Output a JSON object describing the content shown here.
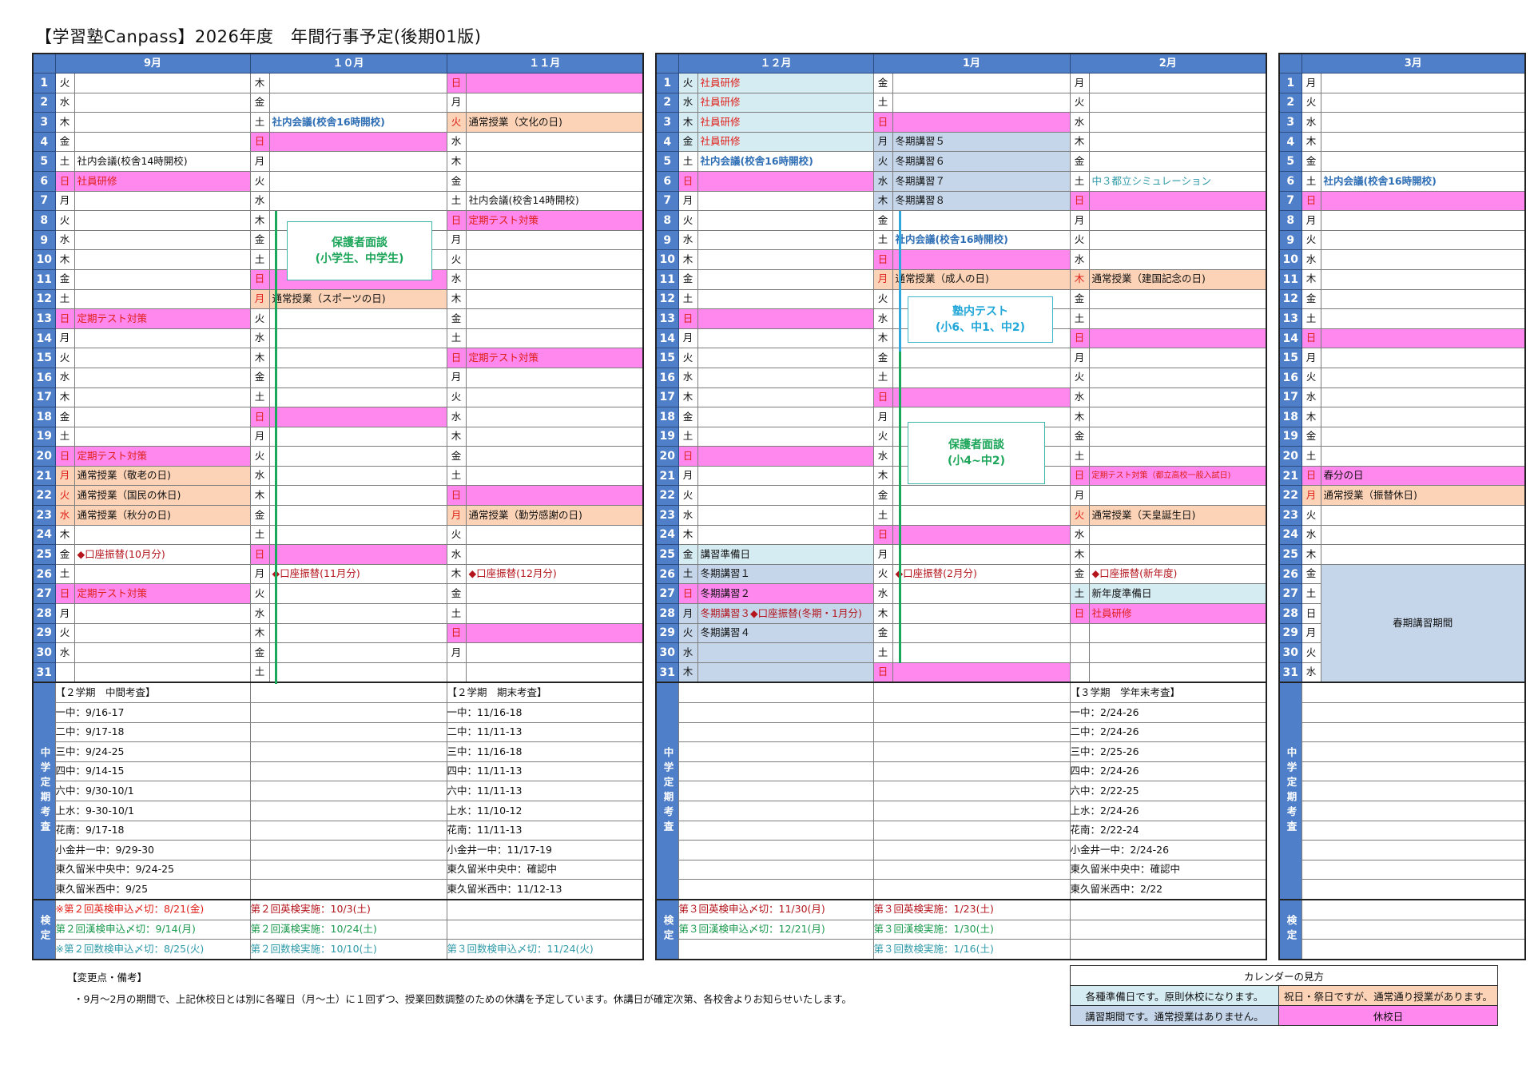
{
  "title": "【学習塾Canpass】2026年度　年間行事予定(後期01版)",
  "months": [
    {
      "name": "9月",
      "days": [
        [
          "火",
          ""
        ],
        [
          "水",
          ""
        ],
        [
          "木",
          ""
        ],
        [
          "金",
          ""
        ],
        [
          "土",
          "社内会議(校舎14時開校)"
        ],
        [
          "日",
          "社員研修"
        ],
        [
          "月",
          ""
        ],
        [
          "火",
          ""
        ],
        [
          "水",
          ""
        ],
        [
          "木",
          ""
        ],
        [
          "金",
          ""
        ],
        [
          "土",
          ""
        ],
        [
          "日",
          "定期テスト対策"
        ],
        [
          "月",
          ""
        ],
        [
          "火",
          ""
        ],
        [
          "水",
          ""
        ],
        [
          "木",
          ""
        ],
        [
          "金",
          ""
        ],
        [
          "土",
          ""
        ],
        [
          "日",
          "定期テスト対策"
        ],
        [
          "月",
          "通常授業（敬老の日)"
        ],
        [
          "火",
          "通常授業（国民の休日)"
        ],
        [
          "水",
          "通常授業（秋分の日)"
        ],
        [
          "木",
          ""
        ],
        [
          "金",
          "◆口座振替(10月分)"
        ],
        [
          "土",
          ""
        ],
        [
          "日",
          "定期テスト対策"
        ],
        [
          "月",
          ""
        ],
        [
          "火",
          ""
        ],
        [
          "水",
          ""
        ],
        [
          "",
          ""
        ]
      ]
    },
    {
      "name": "１０月",
      "days": [
        [
          "木",
          ""
        ],
        [
          "金",
          ""
        ],
        [
          "土",
          "社内会議(校舎16時開校)"
        ],
        [
          "日",
          ""
        ],
        [
          "月",
          ""
        ],
        [
          "火",
          ""
        ],
        [
          "水",
          ""
        ],
        [
          "木",
          ""
        ],
        [
          "金",
          ""
        ],
        [
          "土",
          ""
        ],
        [
          "日",
          ""
        ],
        [
          "月",
          "通常授業（スポーツの日)"
        ],
        [
          "火",
          ""
        ],
        [
          "水",
          ""
        ],
        [
          "木",
          ""
        ],
        [
          "金",
          ""
        ],
        [
          "土",
          ""
        ],
        [
          "日",
          ""
        ],
        [
          "月",
          ""
        ],
        [
          "火",
          ""
        ],
        [
          "水",
          ""
        ],
        [
          "木",
          ""
        ],
        [
          "金",
          ""
        ],
        [
          "土",
          ""
        ],
        [
          "日",
          ""
        ],
        [
          "月",
          "◆口座振替(11月分)"
        ],
        [
          "火",
          ""
        ],
        [
          "水",
          ""
        ],
        [
          "木",
          ""
        ],
        [
          "金",
          ""
        ],
        [
          "土",
          ""
        ]
      ]
    },
    {
      "name": "１１月",
      "days": [
        [
          "日",
          ""
        ],
        [
          "月",
          ""
        ],
        [
          "火",
          "通常授業（文化の日)"
        ],
        [
          "水",
          ""
        ],
        [
          "木",
          ""
        ],
        [
          "金",
          ""
        ],
        [
          "土",
          "社内会議(校舎14時開校)"
        ],
        [
          "日",
          "定期テスト対策"
        ],
        [
          "月",
          ""
        ],
        [
          "火",
          ""
        ],
        [
          "水",
          ""
        ],
        [
          "木",
          ""
        ],
        [
          "金",
          ""
        ],
        [
          "土",
          ""
        ],
        [
          "日",
          "定期テスト対策"
        ],
        [
          "月",
          ""
        ],
        [
          "火",
          ""
        ],
        [
          "水",
          ""
        ],
        [
          "木",
          ""
        ],
        [
          "金",
          ""
        ],
        [
          "土",
          ""
        ],
        [
          "日",
          ""
        ],
        [
          "月",
          "通常授業（勤労感謝の日)"
        ],
        [
          "火",
          ""
        ],
        [
          "水",
          ""
        ],
        [
          "木",
          "◆口座振替(12月分)"
        ],
        [
          "金",
          ""
        ],
        [
          "土",
          ""
        ],
        [
          "日",
          ""
        ],
        [
          "月",
          ""
        ],
        [
          "",
          ""
        ]
      ]
    },
    {
      "name": "１２月",
      "days": [
        [
          "火",
          "社員研修"
        ],
        [
          "水",
          "社員研修"
        ],
        [
          "木",
          "社員研修"
        ],
        [
          "金",
          "社員研修"
        ],
        [
          "土",
          "社内会議(校舎16時開校)"
        ],
        [
          "日",
          ""
        ],
        [
          "月",
          ""
        ],
        [
          "火",
          ""
        ],
        [
          "水",
          ""
        ],
        [
          "木",
          ""
        ],
        [
          "金",
          ""
        ],
        [
          "土",
          ""
        ],
        [
          "日",
          ""
        ],
        [
          "月",
          ""
        ],
        [
          "火",
          ""
        ],
        [
          "水",
          ""
        ],
        [
          "木",
          ""
        ],
        [
          "金",
          ""
        ],
        [
          "土",
          ""
        ],
        [
          "日",
          ""
        ],
        [
          "月",
          ""
        ],
        [
          "火",
          ""
        ],
        [
          "水",
          ""
        ],
        [
          "木",
          ""
        ],
        [
          "金",
          "講習準備日"
        ],
        [
          "土",
          "冬期講習１"
        ],
        [
          "日",
          "冬期講習２"
        ],
        [
          "月",
          "冬期講習３◆口座振替(冬期・1月分)"
        ],
        [
          "火",
          "冬期講習４"
        ],
        [
          "水",
          ""
        ],
        [
          "木",
          ""
        ]
      ]
    },
    {
      "name": "1月",
      "days": [
        [
          "金",
          ""
        ],
        [
          "土",
          ""
        ],
        [
          "日",
          ""
        ],
        [
          "月",
          "冬期講習５"
        ],
        [
          "火",
          "冬期講習６"
        ],
        [
          "水",
          "冬期講習７"
        ],
        [
          "木",
          "冬期講習８"
        ],
        [
          "金",
          ""
        ],
        [
          "土",
          "社内会議(校舎16時開校)"
        ],
        [
          "日",
          ""
        ],
        [
          "月",
          "通常授業（成人の日)"
        ],
        [
          "火",
          ""
        ],
        [
          "水",
          ""
        ],
        [
          "木",
          ""
        ],
        [
          "金",
          ""
        ],
        [
          "土",
          ""
        ],
        [
          "日",
          ""
        ],
        [
          "月",
          ""
        ],
        [
          "火",
          ""
        ],
        [
          "水",
          ""
        ],
        [
          "木",
          ""
        ],
        [
          "金",
          ""
        ],
        [
          "土",
          ""
        ],
        [
          "日",
          ""
        ],
        [
          "月",
          ""
        ],
        [
          "火",
          "◆口座振替(2月分)"
        ],
        [
          "水",
          ""
        ],
        [
          "木",
          ""
        ],
        [
          "金",
          ""
        ],
        [
          "土",
          ""
        ],
        [
          "日",
          ""
        ]
      ]
    },
    {
      "name": "2月",
      "days": [
        [
          "月",
          ""
        ],
        [
          "火",
          ""
        ],
        [
          "水",
          ""
        ],
        [
          "木",
          ""
        ],
        [
          "金",
          ""
        ],
        [
          "土",
          "中３都立シミュレーション"
        ],
        [
          "日",
          ""
        ],
        [
          "月",
          ""
        ],
        [
          "火",
          ""
        ],
        [
          "水",
          ""
        ],
        [
          "木",
          "通常授業（建国記念の日)"
        ],
        [
          "金",
          ""
        ],
        [
          "土",
          ""
        ],
        [
          "日",
          ""
        ],
        [
          "月",
          ""
        ],
        [
          "火",
          ""
        ],
        [
          "水",
          ""
        ],
        [
          "木",
          ""
        ],
        [
          "金",
          ""
        ],
        [
          "土",
          ""
        ],
        [
          "日",
          "定期テスト対策（都立高校一般入試日)"
        ],
        [
          "月",
          ""
        ],
        [
          "火",
          "通常授業（天皇誕生日)"
        ],
        [
          "水",
          ""
        ],
        [
          "木",
          ""
        ],
        [
          "金",
          "◆口座振替(新年度)"
        ],
        [
          "土",
          "新年度準備日"
        ],
        [
          "日",
          "社員研修"
        ],
        [
          "",
          ""
        ],
        [
          "",
          ""
        ],
        [
          "",
          ""
        ]
      ]
    },
    {
      "name": "3月",
      "days": [
        [
          "月",
          ""
        ],
        [
          "火",
          ""
        ],
        [
          "水",
          ""
        ],
        [
          "木",
          ""
        ],
        [
          "金",
          ""
        ],
        [
          "土",
          "社内会議(校舎16時開校)"
        ],
        [
          "日",
          ""
        ],
        [
          "月",
          ""
        ],
        [
          "火",
          ""
        ],
        [
          "水",
          ""
        ],
        [
          "木",
          ""
        ],
        [
          "金",
          ""
        ],
        [
          "土",
          ""
        ],
        [
          "日",
          ""
        ],
        [
          "月",
          ""
        ],
        [
          "火",
          ""
        ],
        [
          "水",
          ""
        ],
        [
          "木",
          ""
        ],
        [
          "金",
          ""
        ],
        [
          "土",
          ""
        ],
        [
          "日",
          "春分の日"
        ],
        [
          "月",
          "通常授業（振替休日)"
        ],
        [
          "火",
          ""
        ],
        [
          "水",
          ""
        ],
        [
          "木",
          ""
        ],
        [
          "金",
          ""
        ],
        [
          "土",
          ""
        ],
        [
          "日",
          ""
        ],
        [
          "月",
          ""
        ],
        [
          "火",
          ""
        ],
        [
          "水",
          ""
        ]
      ]
    }
  ],
  "spring_course": "春期講習期間",
  "callouts": {
    "oct_parent": "保護者面談\n(小学生、中学生)",
    "jan_test": "塾内テスト\n(小6、中1、中2)",
    "jan_parent": "保護者面談\n(小4~中2)"
  },
  "exam_label": "中学定期考査",
  "exams": {
    "sep": [
      "【２学期　中間考査】",
      "一中：9/16-17",
      "二中：9/17-18",
      "三中：9/24-25",
      "四中：9/14-15",
      "六中：9/30-10/1",
      "上水：9-30-10/1",
      "花南：9/17-18",
      "小金井一中：9/29-30",
      "東久留米中央中：9/24-25",
      "東久留米西中：9/25"
    ],
    "nov": [
      "【２学期　期末考査】",
      "一中：11/16-18",
      "二中：11/11-13",
      "三中：11/16-18",
      "四中：11/11-13",
      "六中：11/11-13",
      "上水：11/10-12",
      "花南：11/11-13",
      "小金井一中：11/17-19",
      "東久留米中央中：確認中",
      "東久留米西中：11/12-13"
    ],
    "feb": [
      "【３学期　学年末考査】",
      "一中：2/24-26",
      "二中：2/24-26",
      "三中：2/25-26",
      "四中：2/24-26",
      "六中：2/22-25",
      "上水：2/24-26",
      "花南：2/22-24",
      "小金井一中：2/24-26",
      "東久留米中央中：確認中",
      "東久留米西中：2/22"
    ]
  },
  "kentei_label": "検定",
  "kentei": {
    "sep": [
      "※第２回英検申込〆切：8/21(金)",
      "第２回漢検申込〆切：9/14(月)",
      "※第２回数検申込〆切：8/25(火)"
    ],
    "oct": [
      "第２回英検実施：10/3(土)",
      "第２回漢検実施：10/24(土)",
      "第２回数検実施：10/10(土)"
    ],
    "nov": [
      "",
      "",
      "第３回数検申込〆切：11/24(火)"
    ],
    "dec": [
      "第３回英検申込〆切：11/30(月)",
      "第３回漢検申込〆切：12/21(月)",
      ""
    ],
    "jan": [
      "第３回英検実施：1/23(土)",
      "第３回漢検実施：1/30(土)",
      "第３回数検実施：1/16(土)"
    ]
  },
  "notes": {
    "heading": "【変更点・備考】",
    "body": "・9月～2月の期間で、上記休校日とは別に各曜日（月～土）に１回ずつ、授業回数調整のための休講を予定しています。休講日が確定次第、各校舎よりお知らせいたします。"
  },
  "legend": {
    "title": "カレンダーの見方",
    "prep": "各種準備日です。原則休校になります。",
    "holiday": "祝日・祭日ですが、通常通り授業があります。",
    "course": "講習期間です。通常授業はありません。",
    "closed": "休校日"
  },
  "colors": {
    "header": "#4f7fc9",
    "closed": "#ff88ee",
    "holiday_class": "#fcd3b6",
    "prep": "#d6ecf3",
    "course": "#c5d6ea"
  }
}
